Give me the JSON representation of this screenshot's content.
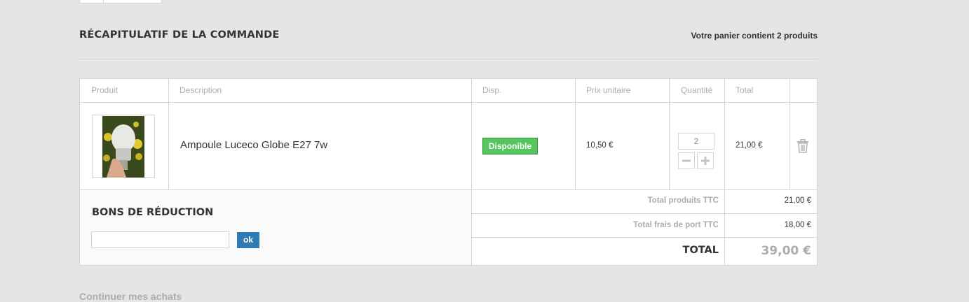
{
  "header": {
    "title": "RÉCAPITULATIF DE LA COMMANDE",
    "cart_count": "Votre panier contient 2 produits"
  },
  "table": {
    "columns": {
      "product": "Produit",
      "description": "Description",
      "availability": "Disp.",
      "unit_price": "Prix unitaire",
      "quantity": "Quantité",
      "total": "Total"
    },
    "rows": [
      {
        "description": "Ampoule Luceco Globe E27 7w",
        "availability": "Disponible",
        "unit_price": "10,50 €",
        "quantity": "2",
        "total": "21,00 €"
      }
    ],
    "icons": {
      "decrease": "minus-icon",
      "increase": "plus-icon",
      "delete": "trash-icon"
    }
  },
  "vouchers": {
    "title": "BONS DE RÉDUCTION",
    "input_value": "",
    "button_label": "ok"
  },
  "summary": {
    "products_label": "Total produits TTC",
    "products_value": "21,00 €",
    "shipping_label": "Total frais de port TTC",
    "shipping_value": "18,00 €",
    "total_label": "TOTAL",
    "total_value": "39,00 €"
  },
  "footer": {
    "continue_label": "Continuer mes achats"
  },
  "colors": {
    "background": "#e5e5e5",
    "available_badge": "#55c65e",
    "ok_button": "#2f7ab2",
    "muted_text": "#adadad"
  }
}
